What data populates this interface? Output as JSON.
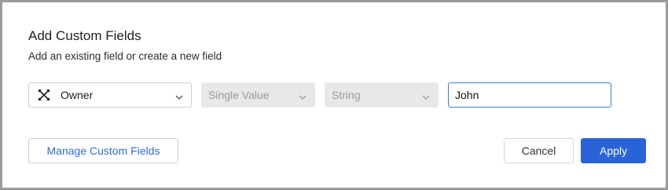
{
  "dialog": {
    "title": "Add Custom Fields",
    "subtitle": "Add an existing field or create a new field"
  },
  "fields": {
    "owner": {
      "value": "Owner",
      "icon": "owner-icon"
    },
    "cardinality": {
      "value": "Single Value"
    },
    "data_type": {
      "value": "String"
    },
    "text_input": {
      "value": "John"
    }
  },
  "buttons": {
    "manage": "Manage Custom Fields",
    "cancel": "Cancel",
    "apply": "Apply"
  },
  "colors": {
    "accent": "#2a62d8",
    "link": "#2f6fd6",
    "disabled_bg": "#e8e8e8",
    "focus_border": "#3b78d8"
  }
}
